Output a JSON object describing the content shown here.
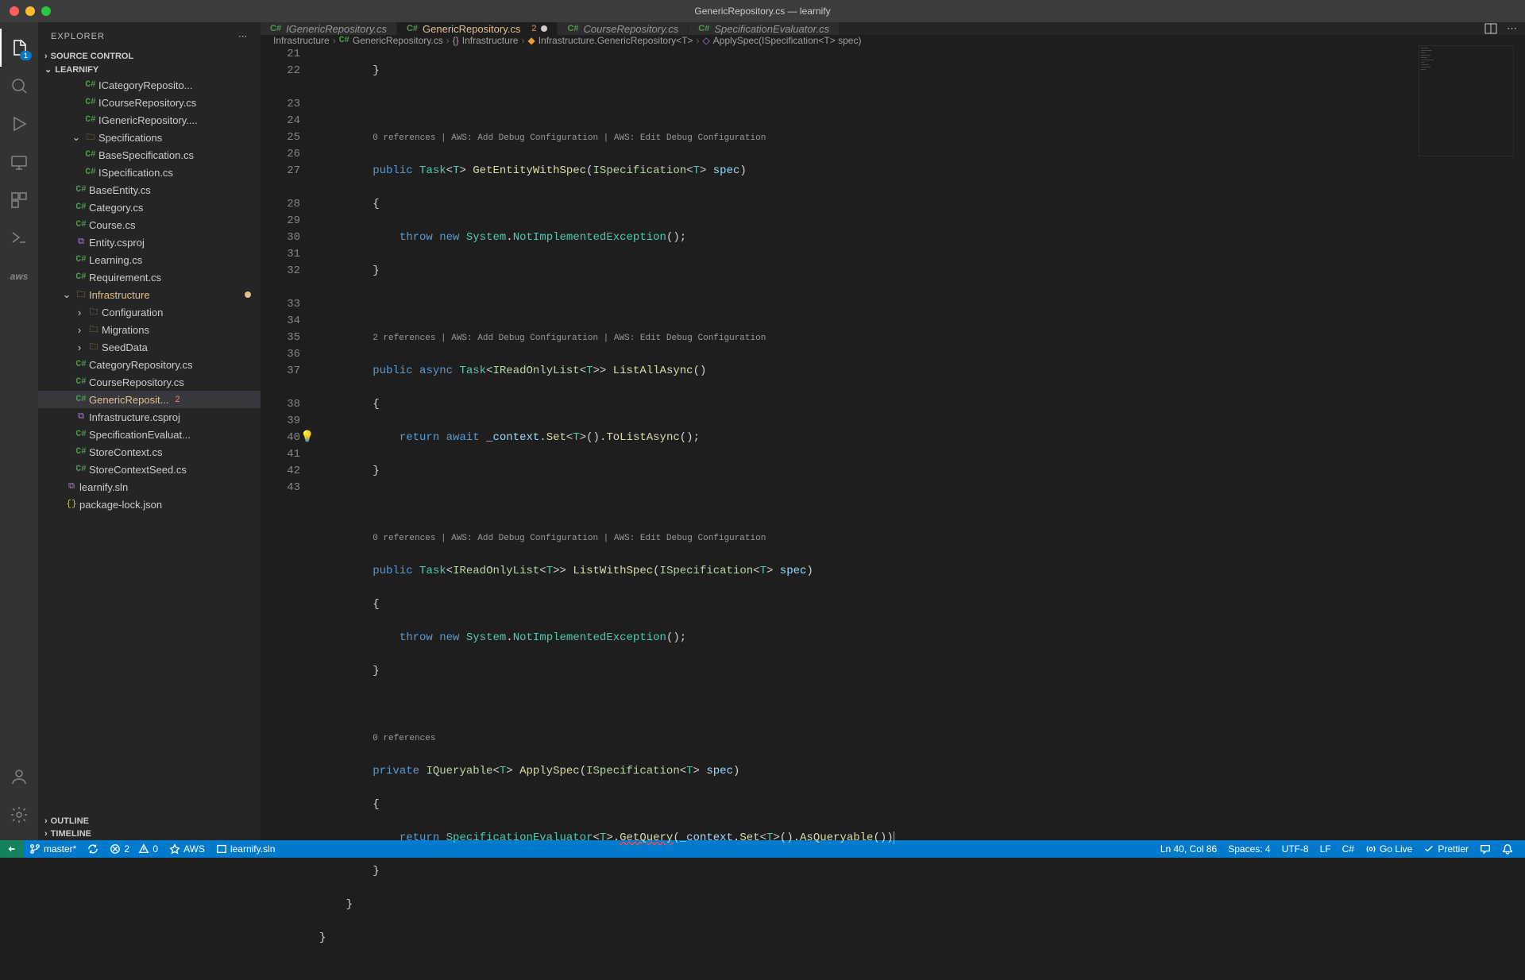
{
  "titlebar": {
    "title": "GenericRepository.cs — learnify"
  },
  "activity": {
    "explorer_badge": "1",
    "aws_label": "aws"
  },
  "sidebar": {
    "title": "EXPLORER",
    "sections": {
      "source_control": "SOURCE CONTROL",
      "learnify": "LEARNIFY",
      "outline": "OUTLINE",
      "timeline": "TIMELINE"
    },
    "tree": {
      "icategory": "ICategoryReposito...",
      "icourse": "ICourseRepository.cs",
      "igeneric": "IGenericRepository....",
      "specifications": "Specifications",
      "basespec": "BaseSpecification.cs",
      "ispec": "ISpecification.cs",
      "baseentity": "BaseEntity.cs",
      "category": "Category.cs",
      "course": "Course.cs",
      "entity_proj": "Entity.csproj",
      "learning": "Learning.cs",
      "requirement": "Requirement.cs",
      "infrastructure": "Infrastructure",
      "configuration": "Configuration",
      "migrations": "Migrations",
      "seeddata": "SeedData",
      "catrepo": "CategoryRepository.cs",
      "courserepo": "CourseRepository.cs",
      "genericrepo": "GenericReposit...",
      "genericrepo_err": "2",
      "infra_proj": "Infrastructure.csproj",
      "speceval": "SpecificationEvaluat...",
      "storectx": "StoreContext.cs",
      "storectxseed": "StoreContextSeed.cs",
      "sln": "learnify.sln",
      "pkg": "package-lock.json"
    }
  },
  "tabs": [
    {
      "label": "IGenericRepository.cs",
      "active": false,
      "italic": true
    },
    {
      "label": "GenericRepository.cs",
      "active": true,
      "modified": true,
      "errors": "2",
      "dirty": true
    },
    {
      "label": "CourseRepository.cs",
      "active": false,
      "italic": true
    },
    {
      "label": "SpecificationEvaluator.cs",
      "active": false,
      "italic": true
    }
  ],
  "breadcrumbs": {
    "p0": "Infrastructure",
    "p1": "GenericRepository.cs",
    "p2": "Infrastructure",
    "p3": "Infrastructure.GenericRepository<T>",
    "p4": "ApplySpec(ISpecification<T> spec)"
  },
  "codelens": {
    "a": "0 references | AWS: Add Debug Configuration | AWS: Edit Debug Configuration",
    "b": "2 references | AWS: Add Debug Configuration | AWS: Edit Debug Configuration",
    "c": "0 references"
  },
  "line_numbers": [
    "21",
    "22",
    "",
    "23",
    "24",
    "25",
    "26",
    "27",
    "",
    "28",
    "29",
    "30",
    "31",
    "32",
    "",
    "33",
    "34",
    "35",
    "36",
    "37",
    "",
    "38",
    "39",
    "40",
    "41",
    "42",
    "43"
  ],
  "statusbar": {
    "branch": "master*",
    "errors": "2",
    "warnings": "0",
    "aws": "AWS",
    "sln": "learnify.sln",
    "position": "Ln 40, Col 86",
    "spaces": "Spaces: 4",
    "encoding": "UTF-8",
    "eol": "LF",
    "lang": "C#",
    "golive": "Go Live",
    "prettier": "Prettier"
  }
}
